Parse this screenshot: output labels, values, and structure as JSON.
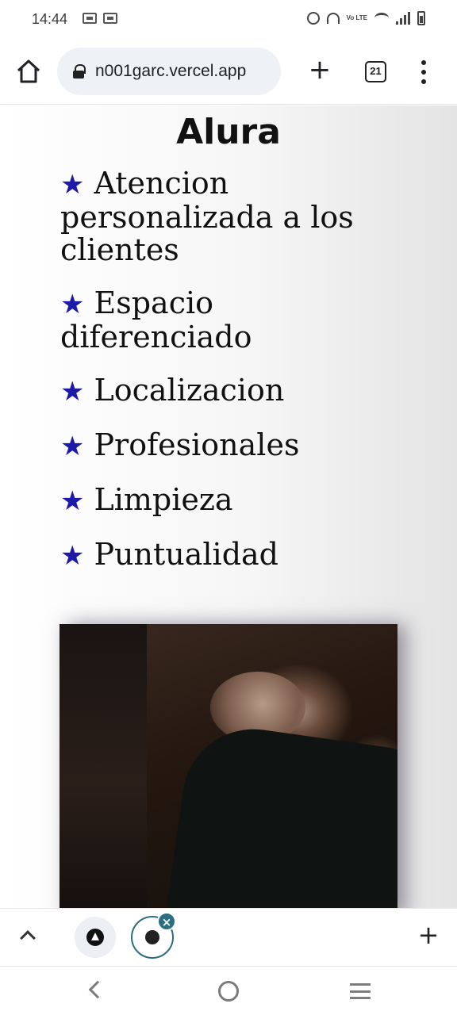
{
  "status_bar": {
    "time": "14:44",
    "network_label": "Vo LTE"
  },
  "browser": {
    "url": "n001garc.vercel.app",
    "tab_count": "21"
  },
  "page": {
    "brand": "Alura",
    "features": [
      "Atencion personalizada a los clientes",
      "Espacio diferenciado",
      "Localizacion",
      "Profesionales",
      "Limpieza",
      "Puntualidad"
    ],
    "feature_icon": "star-icon",
    "star_glyph": "★",
    "accent_color": "#1d1aa8"
  },
  "tab_strip": {
    "close_glyph": "×",
    "new_tab_glyph": "+"
  },
  "toolbar": {
    "new_tab_glyph": "+"
  }
}
